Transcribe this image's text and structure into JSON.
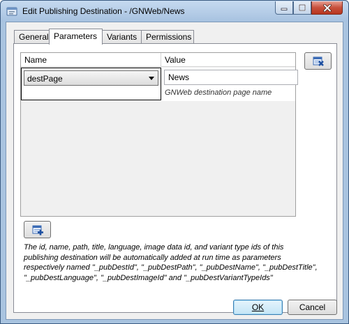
{
  "window": {
    "title": "Edit Publishing Destination - /GNWeb/News",
    "icon": "window-app-icon"
  },
  "caption_buttons": {
    "minimize_icon": "minimize-icon",
    "maximize_icon": "maximize-icon",
    "close_icon": "close-icon"
  },
  "tabs": [
    {
      "label": "General",
      "active": false
    },
    {
      "label": "Parameters",
      "active": true
    },
    {
      "label": "Variants",
      "active": false
    },
    {
      "label": "Permissions",
      "active": false
    }
  ],
  "grid": {
    "columns": [
      "Name",
      "Value"
    ],
    "rows": [
      {
        "name": "destPage",
        "value": "News",
        "hint": "GNWeb destination page name"
      }
    ]
  },
  "buttons": {
    "delete_icon": "delete-parameter-icon",
    "add_icon": "add-parameter-icon",
    "ok_label": "OK",
    "cancel_label": "Cancel"
  },
  "note": {
    "lines": [
      "The id, name, path, title, language, image data id, and variant type ids of this",
      "publishing destination will be automatically added at run time as parameters",
      "respectively named \"_pubDestId\", \"_pubDestPath\", \"_pubDestName\", \"_pubDestTitle\",",
      "\"_pubDestLanguage\", \"_pubDestImageId\" and \"_pubDestVariantTypeIds\""
    ]
  },
  "colors": {
    "title_bar": "#a7c2e0",
    "dialog_bg": "#f0f0f0",
    "ok_accent": "#3c7fb1",
    "close_red": "#c7503c"
  }
}
